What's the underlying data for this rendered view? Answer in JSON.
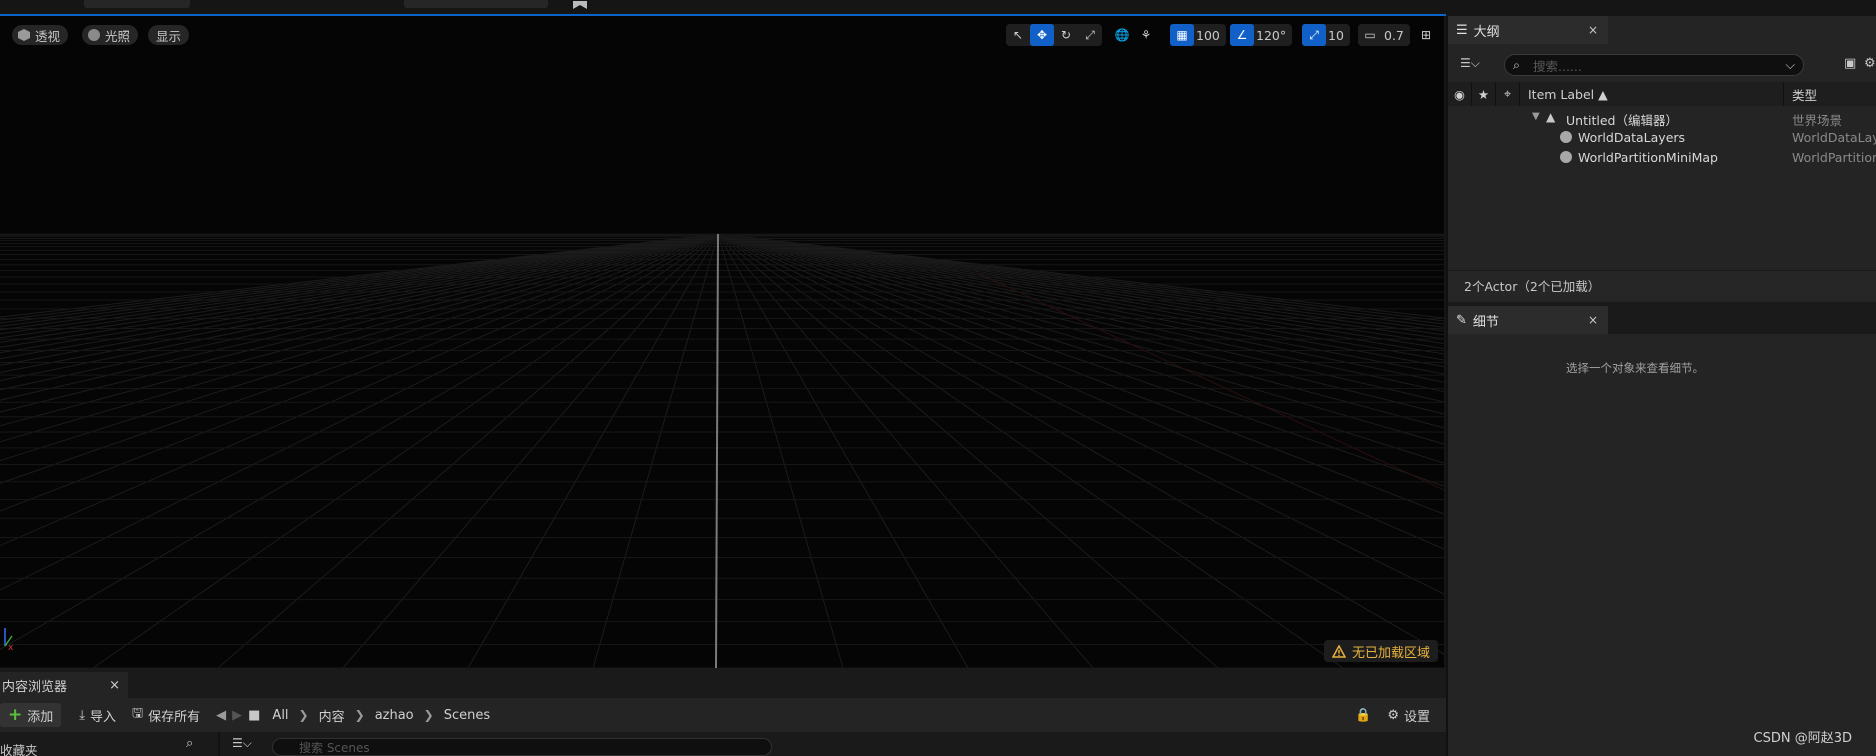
{
  "viewport": {
    "view_mode": "透视",
    "lighting": "光照",
    "show": "显示",
    "grid_snap": "100",
    "rotate_snap": "120°",
    "scale_snap": "10",
    "camera_speed": "0.7",
    "warning": "无已加载区域",
    "axis_label": "x"
  },
  "outliner": {
    "tab_title": "大纲",
    "close": "×",
    "search_placeholder": "搜索......",
    "col_label": "Item Label ▲",
    "col_type": "类型",
    "rows": [
      {
        "name": "Untitled（编辑器）",
        "type": "世界场景"
      },
      {
        "name": "WorldDataLayers",
        "type": "WorldDataLaye"
      },
      {
        "name": "WorldPartitionMiniMap",
        "type": "WorldPartitionM"
      }
    ],
    "status": "2个Actor（2个已加载）"
  },
  "details": {
    "tab_title": "细节",
    "close": "×",
    "hint": "选择一个对象来查看细节。"
  },
  "content_browser": {
    "tab_title": "内容浏览器",
    "close": "×",
    "add": "添加",
    "import": "导入",
    "save_all": "保存所有",
    "breadcrumb": [
      "All",
      "内容",
      "azhao",
      "Scenes"
    ],
    "settings": "设置",
    "favorites": "收藏夹",
    "search_placeholder": "搜索 Scenes"
  },
  "watermark": "CSDN @阿赵3D",
  "colors": {
    "accent": "#1060c8",
    "warning": "#e8b23c",
    "add_green": "#5cbd3c"
  }
}
